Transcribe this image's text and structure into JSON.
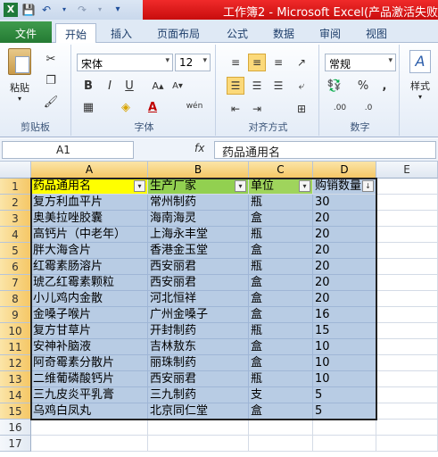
{
  "window": {
    "title": "工作簿2 - Microsoft Excel(产品激活失败)"
  },
  "quick_access": {
    "icons": [
      "save-icon",
      "undo-icon",
      "redo-icon",
      "customize-icon"
    ]
  },
  "ribbon_tabs": [
    {
      "label": "文件",
      "active": false
    },
    {
      "label": "开始",
      "active": true
    },
    {
      "label": "插入",
      "active": false
    },
    {
      "label": "页面布局",
      "active": false
    },
    {
      "label": "公式",
      "active": false
    },
    {
      "label": "数据",
      "active": false
    },
    {
      "label": "审阅",
      "active": false
    },
    {
      "label": "视图",
      "active": false
    }
  ],
  "ribbon": {
    "clipboard": {
      "paste_label": "粘贴",
      "group_label": "剪贴板"
    },
    "font": {
      "font_name": "宋体",
      "font_size": "12",
      "bold": "B",
      "italic": "I",
      "underline": "U",
      "font_color_letter": "A",
      "wen": "wén",
      "group_label": "字体"
    },
    "alignment": {
      "group_label": "对齐方式"
    },
    "number": {
      "format": "常规",
      "percent": "%",
      "comma": ",",
      "group_label": "数字"
    },
    "styles": {
      "styles_label": "样式"
    }
  },
  "formula_bar": {
    "name_box": "A1",
    "fx": "fx",
    "content": "药品通用名"
  },
  "columns": [
    "A",
    "B",
    "C",
    "D",
    "E"
  ],
  "rows": [
    "1",
    "2",
    "3",
    "4",
    "5",
    "6",
    "7",
    "8",
    "9",
    "10",
    "11",
    "12",
    "13",
    "14",
    "15",
    "16",
    "17"
  ],
  "table": {
    "headers": [
      "药品通用名",
      "生产厂家",
      "单位",
      "购销数量"
    ],
    "rows": [
      [
        "复方利血平片",
        "常州制药",
        "瓶",
        "30"
      ],
      [
        "奥美拉唑胶囊",
        "海南海灵",
        "盒",
        "20"
      ],
      [
        "高钙片（中老年）",
        "上海永丰堂",
        "瓶",
        "20"
      ],
      [
        "胖大海含片",
        "香港金玉堂",
        "盒",
        "20"
      ],
      [
        "红霉素肠溶片",
        "西安丽君",
        "瓶",
        "20"
      ],
      [
        "琥乙红霉素颗粒",
        "西安丽君",
        "盒",
        "20"
      ],
      [
        "小儿鸡内金散",
        "河北恒祥",
        "盒",
        "20"
      ],
      [
        "金嗓子喉片",
        "广州金嗓子",
        "盒",
        "16"
      ],
      [
        "复方甘草片",
        "开封制药",
        "瓶",
        "15"
      ],
      [
        "安神补脑液",
        "吉林敖东",
        "盒",
        "10"
      ],
      [
        "阿奇霉素分散片",
        "丽珠制药",
        "盒",
        "10"
      ],
      [
        "二维葡磷酸钙片",
        "西安丽君",
        "瓶",
        "10"
      ],
      [
        "三九皮炎平乳膏",
        "三九制药",
        "支",
        "5"
      ],
      [
        "乌鸡白凤丸",
        "北京同仁堂",
        "盒",
        "5"
      ]
    ]
  },
  "colors": {
    "title_bar": "#e01b1b",
    "file_tab": "#2f8a3e",
    "header_a": "#ffff00",
    "header_b": "#92d050",
    "data_fill": "#b8cce4"
  }
}
